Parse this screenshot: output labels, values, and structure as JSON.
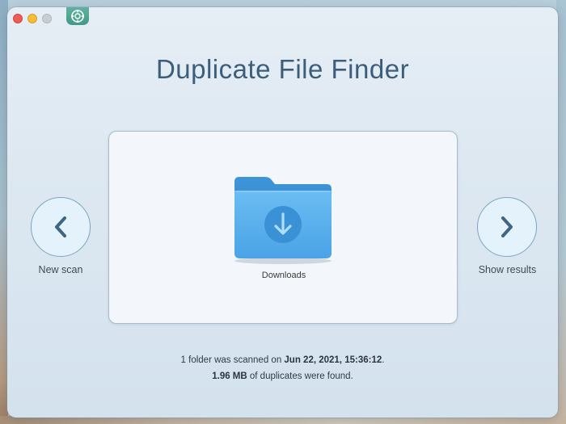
{
  "app": {
    "title": "Duplicate File Finder",
    "icon": "app-logo-icon"
  },
  "window_controls": [
    "close",
    "minimize",
    "zoom"
  ],
  "navigation": {
    "back": {
      "label": "New scan",
      "icon": "chevron-left-icon"
    },
    "forward": {
      "label": "Show results",
      "icon": "chevron-right-icon"
    }
  },
  "folder": {
    "name": "Downloads",
    "icon": "downloads-folder-icon"
  },
  "status": {
    "line1_prefix": "1 folder was scanned on ",
    "scan_datetime": "Jun 22, 2021, 15:36:12",
    "line1_suffix": ".",
    "duplicates_size": "1.96 MB",
    "line2_suffix": " of duplicates were found."
  },
  "colors": {
    "accent": "#3d5e7b",
    "folder": "#4ea3e6",
    "close": "#ee5c56",
    "minimize": "#f5bd35",
    "zoom_disabled": "#c9ced3"
  }
}
